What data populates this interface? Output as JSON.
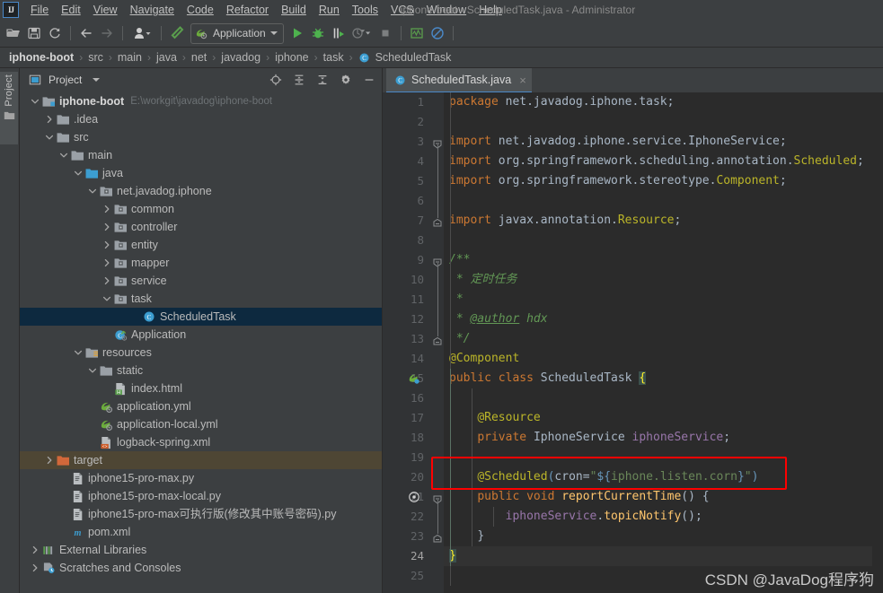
{
  "window": {
    "title": "iphone-boot - ScheduledTask.java - Administrator",
    "logo": "ij-logo"
  },
  "menubar": {
    "items": [
      {
        "label": "File"
      },
      {
        "label": "Edit"
      },
      {
        "label": "View"
      },
      {
        "label": "Navigate"
      },
      {
        "label": "Code"
      },
      {
        "label": "Refactor"
      },
      {
        "label": "Build"
      },
      {
        "label": "Run"
      },
      {
        "label": "Tools"
      },
      {
        "label": "VCS"
      },
      {
        "label": "Window"
      },
      {
        "label": "Help"
      }
    ]
  },
  "toolbar": {
    "run_config_label": "Application",
    "buttons": [
      {
        "name": "open-folder-icon"
      },
      {
        "name": "save-all-icon"
      },
      {
        "name": "sync-refresh-icon"
      },
      {
        "name": "back-arrow-icon"
      },
      {
        "name": "forward-arrow-icon"
      },
      {
        "name": "user-profile-icon"
      },
      {
        "name": "build-hammer-icon"
      },
      {
        "name": "run-icon"
      },
      {
        "name": "debug-icon"
      },
      {
        "name": "run-with-coverage-icon"
      },
      {
        "name": "profile-icon"
      },
      {
        "name": "stop-icon"
      },
      {
        "name": "activity-monitor-icon"
      },
      {
        "name": "no-entry-icon"
      }
    ]
  },
  "breadcrumb": {
    "items": [
      "iphone-boot",
      "src",
      "main",
      "java",
      "net",
      "javadog",
      "iphone",
      "task",
      "ScheduledTask"
    ],
    "separator": "›"
  },
  "rail": {
    "project_label": "Project"
  },
  "project_panel": {
    "title": "Project",
    "tree": [
      {
        "depth": 0,
        "arrow": "down",
        "icon": "module-icon",
        "label": "iphone-boot",
        "bold": true,
        "hint": "E:\\workgit\\javadog\\iphone-boot"
      },
      {
        "depth": 1,
        "arrow": "right",
        "icon": "folder-icon",
        "label": ".idea"
      },
      {
        "depth": 1,
        "arrow": "down",
        "icon": "folder-icon",
        "label": "src"
      },
      {
        "depth": 2,
        "arrow": "down",
        "icon": "folder-icon",
        "label": "main"
      },
      {
        "depth": 3,
        "arrow": "down",
        "icon": "source-root-icon",
        "label": "java"
      },
      {
        "depth": 4,
        "arrow": "down",
        "icon": "package-icon",
        "label": "net.javadog.iphone"
      },
      {
        "depth": 5,
        "arrow": "right",
        "icon": "package-icon",
        "label": "common"
      },
      {
        "depth": 5,
        "arrow": "right",
        "icon": "package-icon",
        "label": "controller"
      },
      {
        "depth": 5,
        "arrow": "right",
        "icon": "package-icon",
        "label": "entity"
      },
      {
        "depth": 5,
        "arrow": "right",
        "icon": "package-icon",
        "label": "mapper"
      },
      {
        "depth": 5,
        "arrow": "right",
        "icon": "package-icon",
        "label": "service"
      },
      {
        "depth": 5,
        "arrow": "down",
        "icon": "package-icon",
        "label": "task"
      },
      {
        "depth": 7,
        "arrow": "none",
        "icon": "java-class-icon",
        "label": "ScheduledTask",
        "selected": true
      },
      {
        "depth": 5,
        "arrow": "none",
        "icon": "spring-boot-icon",
        "label": "Application"
      },
      {
        "depth": 3,
        "arrow": "down",
        "icon": "resources-root-icon",
        "label": "resources"
      },
      {
        "depth": 4,
        "arrow": "down",
        "icon": "folder-icon",
        "label": "static"
      },
      {
        "depth": 5,
        "arrow": "none",
        "icon": "html-file-icon",
        "label": "index.html"
      },
      {
        "depth": 4,
        "arrow": "none",
        "icon": "spring-yml-icon",
        "label": "application.yml"
      },
      {
        "depth": 4,
        "arrow": "none",
        "icon": "spring-yml-icon",
        "label": "application-local.yml"
      },
      {
        "depth": 4,
        "arrow": "none",
        "icon": "xml-file-icon",
        "label": "logback-spring.xml"
      },
      {
        "depth": 1,
        "arrow": "right",
        "icon": "target-folder-icon",
        "label": "target",
        "target": true
      },
      {
        "depth": 2,
        "arrow": "none",
        "icon": "python-file-icon",
        "label": "iphone15-pro-max.py"
      },
      {
        "depth": 2,
        "arrow": "none",
        "icon": "python-file-icon",
        "label": "iphone15-pro-max-local.py"
      },
      {
        "depth": 2,
        "arrow": "none",
        "icon": "python-file-icon",
        "label": "iphone15-pro-max可执行版(修改其中账号密码).py"
      },
      {
        "depth": 2,
        "arrow": "none",
        "icon": "maven-pom-icon",
        "label": "pom.xml"
      },
      {
        "depth": 0,
        "arrow": "right",
        "icon": "external-libraries-icon",
        "label": "External Libraries"
      },
      {
        "depth": 0,
        "arrow": "right",
        "icon": "scratches-icon",
        "label": "Scratches and Consoles"
      }
    ]
  },
  "editor": {
    "tab": {
      "label": "ScheduledTask.java",
      "icon": "java-class-icon",
      "close": "×"
    },
    "line_numbers": [
      "1",
      "2",
      "3",
      "4",
      "5",
      "6",
      "7",
      "8",
      "9",
      "10",
      "11",
      "12",
      "13",
      "14",
      "15",
      "16",
      "17",
      "18",
      "19",
      "20",
      "21",
      "22",
      "23",
      "24",
      "25"
    ],
    "current_line": 24,
    "lines": [
      {
        "n": 1,
        "text": "    package net.javadog.iphone.task;"
      },
      {
        "n": 2,
        "text": ""
      },
      {
        "n": 3,
        "text": "import net.javadog.iphone.service.IphoneService;"
      },
      {
        "n": 4,
        "text": "import org.springframework.scheduling.annotation.Scheduled;"
      },
      {
        "n": 5,
        "text": "import org.springframework.stereotype.Component;"
      },
      {
        "n": 6,
        "text": ""
      },
      {
        "n": 7,
        "text": "import javax.annotation.Resource;"
      },
      {
        "n": 8,
        "text": ""
      },
      {
        "n": 9,
        "text": "/**"
      },
      {
        "n": 10,
        "text": " * 定时任务"
      },
      {
        "n": 11,
        "text": " *"
      },
      {
        "n": 12,
        "text": " * @author hdx"
      },
      {
        "n": 13,
        "text": " */"
      },
      {
        "n": 14,
        "text": "@Component"
      },
      {
        "n": 15,
        "text": "public class ScheduledTask {"
      },
      {
        "n": 16,
        "text": ""
      },
      {
        "n": 17,
        "text": "    @Resource"
      },
      {
        "n": 18,
        "text": "    private IphoneService iphoneService;"
      },
      {
        "n": 19,
        "text": ""
      },
      {
        "n": 20,
        "text": "    @Scheduled(cron=\"${iphone.listen.corn}\")"
      },
      {
        "n": 21,
        "text": "    public void reportCurrentTime() {"
      },
      {
        "n": 22,
        "text": "        iphoneService.topicNotify();"
      },
      {
        "n": 23,
        "text": "    }"
      },
      {
        "n": 24,
        "text": "}"
      },
      {
        "n": 25,
        "text": ""
      }
    ],
    "annotation": {
      "name": "red-highlight-box",
      "color": "#ff0000"
    }
  },
  "watermark": {
    "text": "CSDN @JavaDog程序狗"
  },
  "colors": {
    "background": "#3c3f41",
    "editor_background": "#2b2b2b",
    "gutter": "#313335",
    "accent": "#4a88c7",
    "selection": "#0d293f",
    "target_row": "#4e4634",
    "keyword": "#cc7832",
    "string": "#6a8759",
    "comment": "#629755",
    "annotation": "#bbb529",
    "field": "#9876aa",
    "method": "#ffc66d",
    "text": "#a9b7c6",
    "red_box": "#ff0000"
  }
}
